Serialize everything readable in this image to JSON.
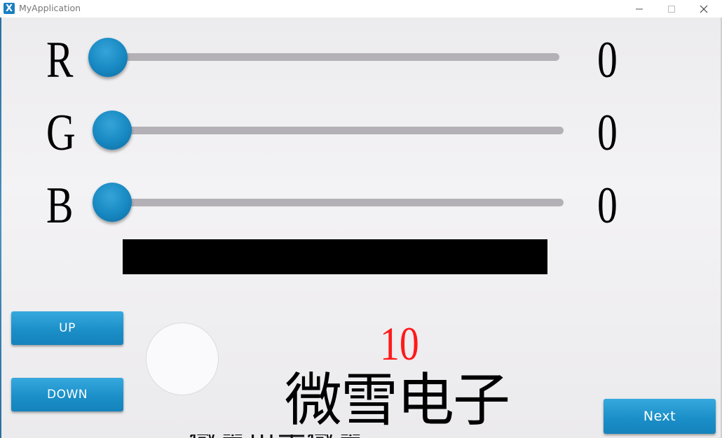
{
  "window": {
    "app_icon": "X",
    "title": "MyApplication",
    "min_glyph": "—",
    "max_glyph": "☐",
    "close_glyph": "✕"
  },
  "sliders": [
    {
      "label": "R",
      "value": "0",
      "level": 0
    },
    {
      "label": "G",
      "value": "0",
      "level": 0
    },
    {
      "label": "B",
      "value": "0",
      "level": 0
    }
  ],
  "preview": {
    "color": "#000000"
  },
  "buttons": {
    "up": "UP",
    "down": "DOWN",
    "next": "Next"
  },
  "counter": "10",
  "brand": "微雪电子",
  "colors": {
    "accent": "#1b8fc8",
    "counter": "#ff1a1a",
    "track": "#b3b1b5"
  }
}
